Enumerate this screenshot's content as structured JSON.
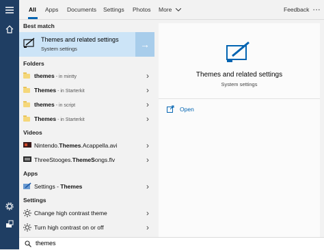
{
  "tabs": [
    {
      "label": "All",
      "active": true
    },
    {
      "label": "Apps",
      "active": false
    },
    {
      "label": "Documents",
      "active": false
    },
    {
      "label": "Settings",
      "active": false
    },
    {
      "label": "Photos",
      "active": false
    },
    {
      "label": "More",
      "active": false
    }
  ],
  "feedback_label": "Feedback",
  "more_icon": "ellipsis-icon",
  "sections": {
    "best_match": "Best match",
    "folders": "Folders",
    "videos": "Videos",
    "apps": "Apps",
    "settings": "Settings"
  },
  "best_match": {
    "title": "Themes and related settings",
    "subtitle": "System settings",
    "arrow": "→"
  },
  "folders": [
    {
      "name": "themes",
      "suffix": " - in mintty"
    },
    {
      "name": "Themes",
      "suffix": " - in Starterkit"
    },
    {
      "name": "themes",
      "suffix": " - in script"
    },
    {
      "name": "Themes",
      "suffix": " - in Starterkit"
    }
  ],
  "videos": [
    {
      "pre": "Nintendo.",
      "bold": "Themes",
      "post": ".Acappella.avi"
    },
    {
      "pre": "ThreeStooges.",
      "bold": "ThemeS",
      "post": "ongs.flv"
    }
  ],
  "apps": [
    {
      "pre": "Settings - ",
      "bold": "Themes"
    }
  ],
  "settings_items": [
    {
      "label": "Change high contrast theme"
    },
    {
      "label": "Turn high contrast on or off"
    }
  ],
  "detail": {
    "title": "Themes and related settings",
    "subtitle": "System settings",
    "open_label": "Open"
  },
  "search": {
    "value": "themes"
  },
  "colors": {
    "rail": "#1f3e63",
    "accent": "#0063b1",
    "selected_bg": "#cce4f7"
  },
  "chevron": "›"
}
